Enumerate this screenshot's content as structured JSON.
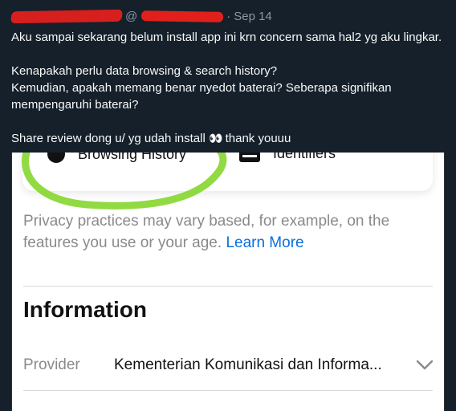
{
  "tweet": {
    "handle_prefix": "@",
    "separator": "·",
    "date": "Sep 14",
    "lines": [
      "Aku sampai sekarang belum install app ini krn concern sama hal2 yg aku lingkar.",
      "Kenapakah perlu data browsing & search history?",
      "Kemudian, apakah memang benar nyedot baterai? Seberapa signifikan",
      "mempengaruhi baterai?",
      "Share review dong u/ yg udah install",
      "👀",
      "thank youuu"
    ]
  },
  "screenshot": {
    "browsing_label": "Browsing History",
    "identifiers_label": "Identifiers",
    "privacy_text": "Privacy practices may vary based, for example, on the features you use or your age.",
    "learn_more": "Learn More",
    "info_title": "Information",
    "provider_label": "Provider",
    "provider_value": "Kementerian Komunikasi dan Informa..."
  },
  "colors": {
    "background": "#15202b",
    "redaction": "#e1201c",
    "highlight_ring": "#7ed321",
    "link": "#0a6fe0"
  }
}
